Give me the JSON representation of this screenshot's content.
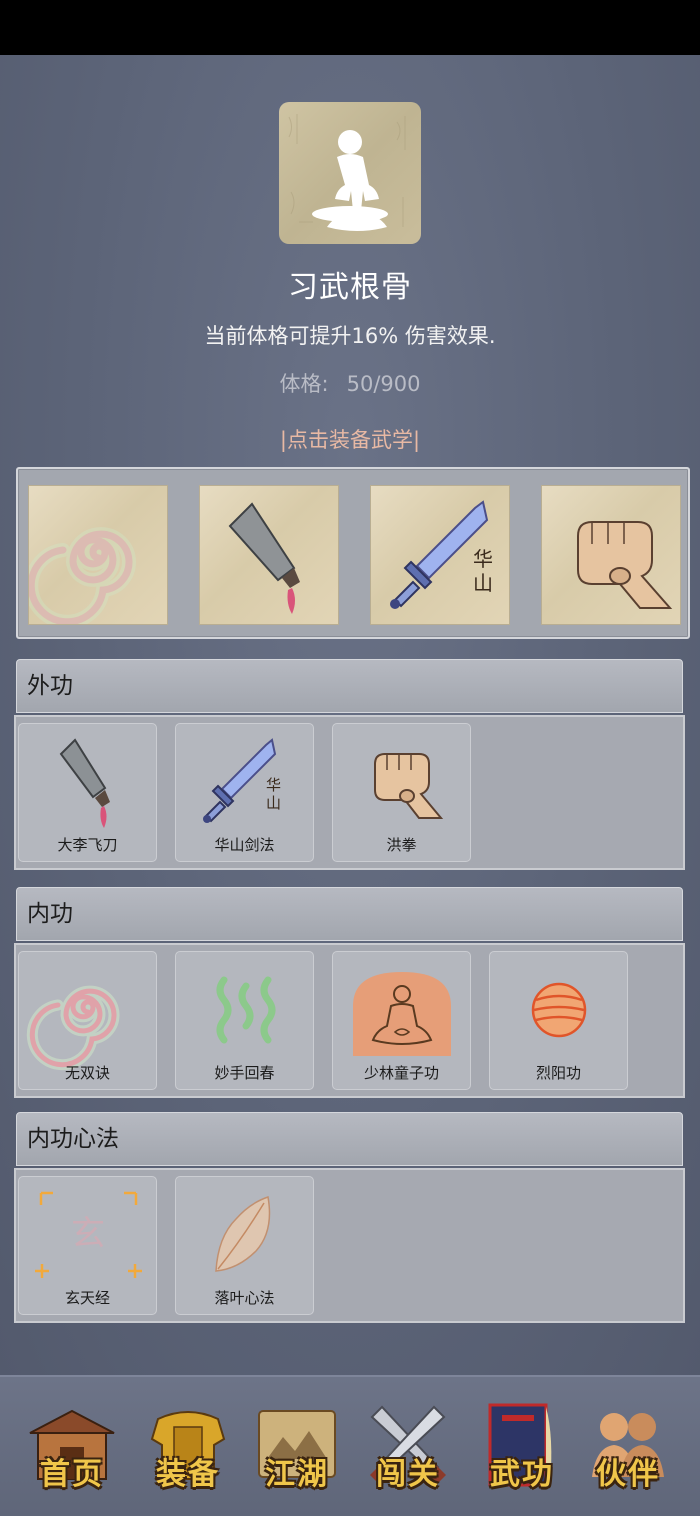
{
  "header": {
    "portrait_icon": "meditation-icon",
    "title": "习武根骨",
    "description": "当前体格可提升16% 伤害效果.",
    "stat_label": "体格:",
    "stat_value": "50/900",
    "equip_link": "|点击装备武学|"
  },
  "equipped_slots": [
    {
      "icon": "swirl-icon"
    },
    {
      "icon": "cleaver-icon"
    },
    {
      "icon": "huashan-sword-icon"
    },
    {
      "icon": "fist-icon"
    }
  ],
  "sections": [
    {
      "title": "外功",
      "skills": [
        {
          "label": "大李飞刀",
          "icon": "cleaver-icon"
        },
        {
          "label": "华山剑法",
          "icon": "huashan-sword-icon"
        },
        {
          "label": "洪拳",
          "icon": "fist-icon"
        }
      ]
    },
    {
      "title": "内功",
      "skills": [
        {
          "label": "无双诀",
          "icon": "swirl-icon"
        },
        {
          "label": "妙手回春",
          "icon": "green-waves-icon"
        },
        {
          "label": "少林童子功",
          "icon": "meditating-monk-icon"
        },
        {
          "label": "烈阳功",
          "icon": "sun-orb-icon"
        }
      ]
    },
    {
      "title": "内功心法",
      "skills": [
        {
          "label": "玄天经",
          "icon": "xuan-glyph-icon"
        },
        {
          "label": "落叶心法",
          "icon": "leaf-icon"
        }
      ]
    }
  ],
  "sword_glyph": [
    "华",
    "山"
  ],
  "xuan_glyph": "玄",
  "nav": [
    {
      "label": "首页",
      "icon": "house-icon"
    },
    {
      "label": "装备",
      "icon": "armor-icon"
    },
    {
      "label": "江湖",
      "icon": "scroll-map-icon"
    },
    {
      "label": "闯关",
      "icon": "crossed-swords-icon"
    },
    {
      "label": "武功",
      "icon": "book-icon"
    },
    {
      "label": "伙伴",
      "icon": "partners-icon"
    }
  ],
  "colors": {
    "background": "#5b6377",
    "panel": "#a6a9b1",
    "link": "#e8b9a4",
    "nav_label": "#f0c64a"
  }
}
